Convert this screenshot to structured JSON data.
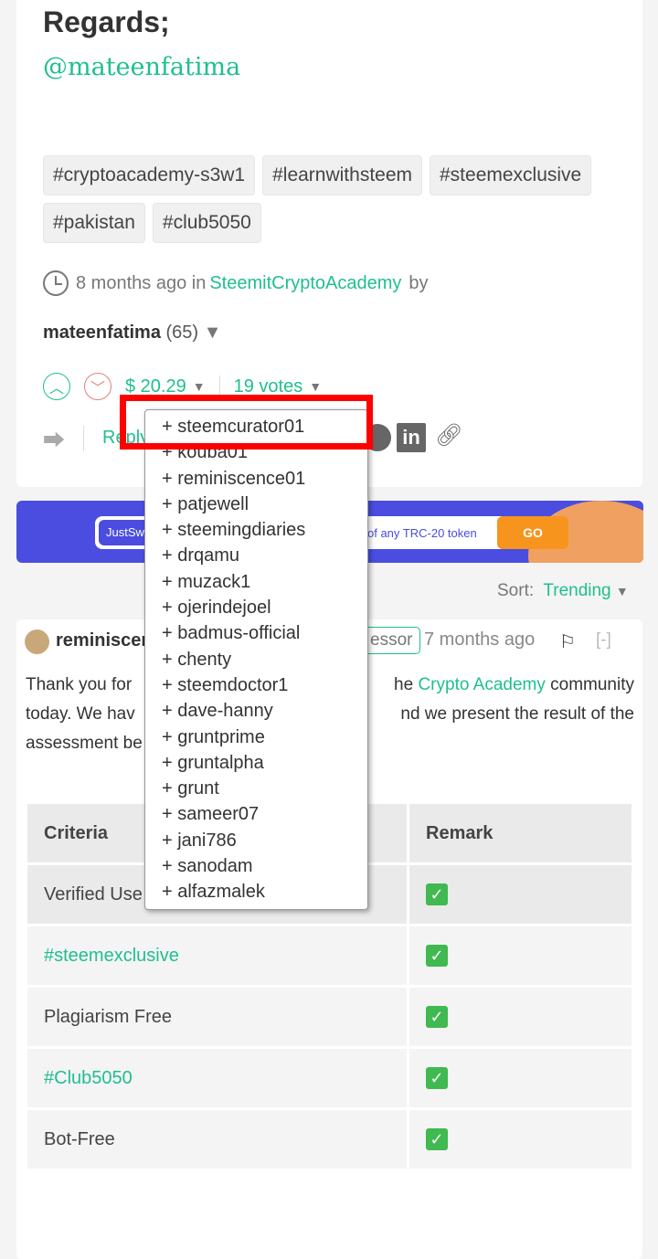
{
  "post": {
    "regards": "Regards;",
    "author_link": "@mateenfatima",
    "tags": [
      "#cryptoacademy-s3w1",
      "#learnwithsteem",
      "#steemexclusive",
      "#pakistan",
      "#club5050"
    ],
    "time": "8 months ago in",
    "community": "SteemitCryptoAcademy",
    "by": "by",
    "author": "mateenfatima",
    "reputation": "(65)",
    "payout": "$ 20.29",
    "votes": "19 votes",
    "reply": "Reply"
  },
  "voters": [
    "+ steemcurator01",
    "+ kouba01",
    "+ reminiscence01",
    "+ patjewell",
    "+ steemingdiaries",
    "+ drqamu",
    "+ muzack1",
    "+ ojerindejoel",
    "+ badmus-official",
    "+ chenty",
    "+ steemdoctor1",
    "+ dave-hanny",
    "+ gruntprime",
    "+ gruntalpha",
    "+ grunt",
    "+ sameer07",
    "+ jani786",
    "+ sanodam",
    "+ alfazmalek"
  ],
  "ad": {
    "brand": "JustSw",
    "text": "of any TRC-20 token",
    "go": "GO"
  },
  "sort": {
    "label": "Sort:",
    "value": "Trending"
  },
  "comment": {
    "author": "reminiscen",
    "badge": "essor",
    "time": "7 months ago",
    "collapse": "[-]",
    "text1": "Thank you for",
    "text_link": "Crypto Academy",
    "text2": "community",
    "text3": "today. We hav",
    "text4": "nd we present the result of the",
    "text5": "assessment be",
    "pre_link": "he",
    "table": {
      "headers": [
        "Criteria",
        "Remark"
      ],
      "rows": [
        [
          "Verified Use",
          "✓"
        ],
        [
          "#steemexclusive",
          "✓"
        ],
        [
          "Plagiarism Free",
          "✓"
        ],
        [
          "#Club5050",
          "✓"
        ],
        [
          "Bot-Free",
          "✓"
        ]
      ]
    }
  },
  "colors": {
    "accent": "#1fbf8f",
    "highlight": "#ff0000",
    "downvote": "#e08080"
  }
}
